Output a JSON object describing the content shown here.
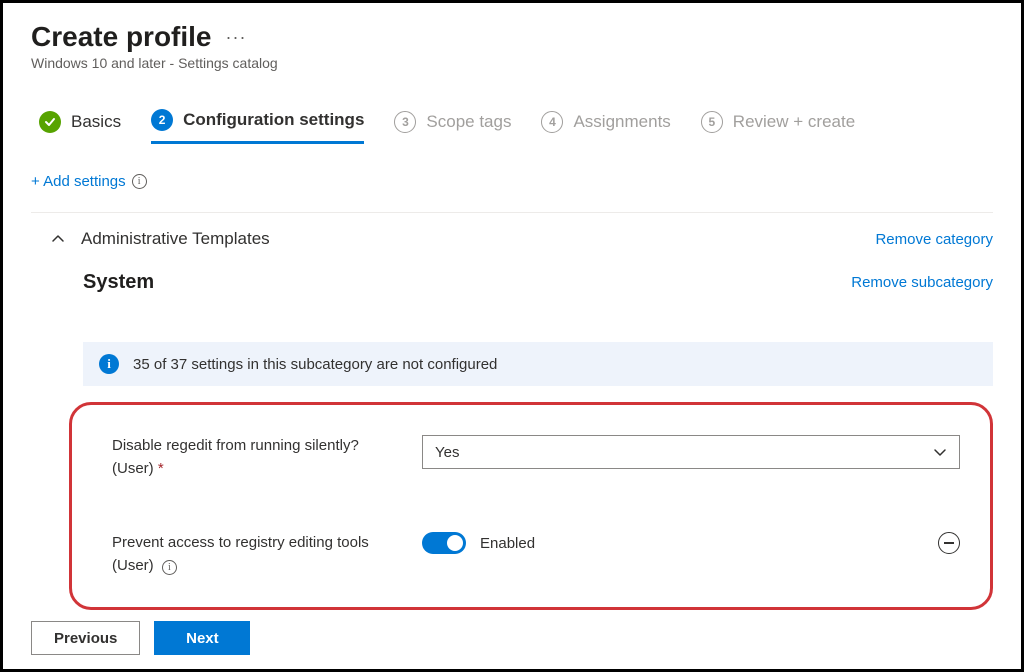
{
  "header": {
    "title": "Create profile",
    "subtitle": "Windows 10 and later - Settings catalog"
  },
  "tabs": [
    {
      "num": "",
      "label": "Basics"
    },
    {
      "num": "2",
      "label": "Configuration settings"
    },
    {
      "num": "3",
      "label": "Scope tags"
    },
    {
      "num": "4",
      "label": "Assignments"
    },
    {
      "num": "5",
      "label": "Review + create"
    }
  ],
  "actions": {
    "add_settings": "+ Add settings"
  },
  "category": {
    "title": "Administrative Templates",
    "remove": "Remove category"
  },
  "subcategory": {
    "title": "System",
    "remove": "Remove subcategory"
  },
  "banner": {
    "text": "35 of 37 settings in this subcategory are not configured"
  },
  "settings": {
    "regedit_silent": {
      "label_line1": "Disable regedit from running silently?",
      "label_line2": "(User)",
      "required_mark": "*",
      "value": "Yes"
    },
    "prevent_regedit": {
      "label_line1": "Prevent access to registry editing tools",
      "label_line2": "(User)",
      "toggle_label": "Enabled"
    }
  },
  "footer": {
    "previous": "Previous",
    "next": "Next"
  }
}
